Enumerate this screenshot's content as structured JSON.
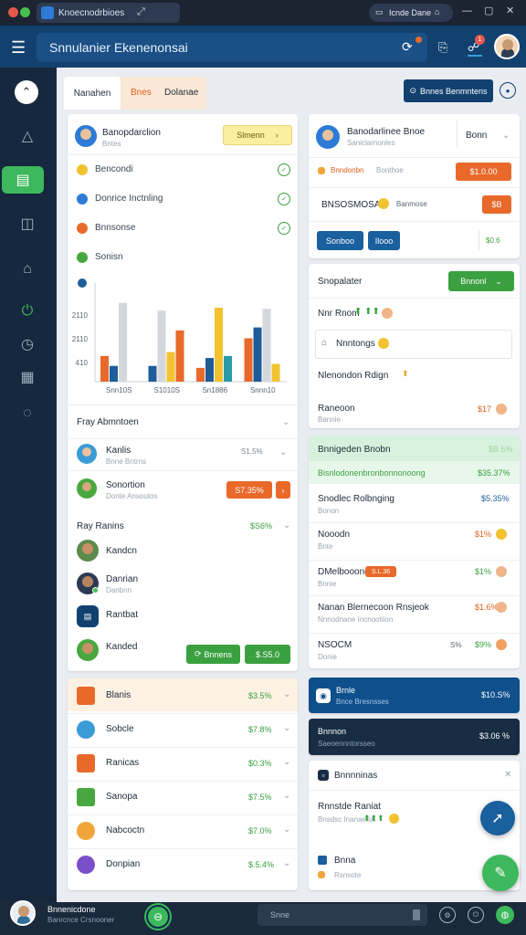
{
  "titlebar": {
    "tab_title": "Knoecnodrbioes",
    "url_text": "Icnde Dane"
  },
  "header": {
    "title": "Snnulanier Ekenenonsai",
    "badge": "1"
  },
  "top_tabs": {
    "tab1": "Nanahen",
    "tab2": "Bnes",
    "tab3": "Dolanae",
    "right_button": "Bnnes Benmntens"
  },
  "left_card": {
    "user_name": "Banopdarclion",
    "user_sub": "Bntes",
    "header_button": "Slmenn",
    "items": [
      {
        "label": "Bencondi",
        "color": "#f2c230"
      },
      {
        "label": "Donrice Inctnling",
        "color": "#2d7bd6"
      },
      {
        "label": "Bnnsonse",
        "color": "#e8692a"
      },
      {
        "label": "Sonisn",
        "color": "#48a83f"
      }
    ],
    "chart_ticks": [
      "2110",
      "2110",
      "410"
    ],
    "chart_categories": [
      "Snn10S",
      "S1010S",
      "Sn1886",
      "Snnn10"
    ]
  },
  "chart_data": {
    "type": "bar",
    "y_ticks": [
      "410",
      "2110",
      "2110"
    ],
    "categories": [
      "Snn10S",
      "S1010S",
      "Sn1886",
      "Snnn10"
    ],
    "series": [
      {
        "color": "#e8692a",
        "values": [
          26,
          0,
          14,
          44
        ]
      },
      {
        "color": "#1e5d9a",
        "values": [
          16,
          16,
          24,
          55
        ]
      },
      {
        "color": "#d4d7db",
        "values": [
          80,
          72,
          0,
          74
        ]
      },
      {
        "color": "#f2c230",
        "values": [
          0,
          30,
          75,
          18
        ]
      },
      {
        "color": "#e8692a",
        "values": [
          0,
          52,
          0,
          0
        ]
      },
      {
        "color": "#2a9aa8",
        "values": [
          0,
          0,
          26,
          0
        ]
      }
    ]
  },
  "fray_abms": {
    "title": "Fray Abmntoen"
  },
  "people": [
    {
      "name": "Kanlis",
      "sub": "Bnne Bntrns",
      "value": "S1.5%"
    },
    {
      "name": "Sonortion",
      "sub": "Donte Ansoutos",
      "button": "S7.35%"
    }
  ],
  "ray_ranins": {
    "title": "Ray Ranins",
    "value": "$S6%",
    "items": [
      "Kandcn",
      "Danrian",
      "Rantbat",
      "Kanded"
    ],
    "btn1": "Bnnens",
    "btn2": "$.S5.0"
  },
  "bottom_list": [
    {
      "name": "Blanis",
      "value": "$3.5%",
      "color": "#e8692a"
    },
    {
      "name": "Sobcle",
      "value": "$7.8%",
      "color": "#3b9bd6"
    },
    {
      "name": "Ranicas",
      "value": "$0.3%",
      "color": "#e8692a"
    },
    {
      "name": "Sanopa",
      "value": "$7.5%",
      "color": "#48a83f"
    },
    {
      "name": "Nabcoctn",
      "value": "$7.0%",
      "color": "#f0a53a"
    },
    {
      "name": "Donpian",
      "value": "$.5.4%",
      "color": "#7a4fc9"
    }
  ],
  "right_card1": {
    "name": "Banodarlinee Bnoe",
    "sub": "Saniclarnonles",
    "select": "Bonn",
    "line1_a": "Bnndonbn",
    "line1_b": "Bonthoe",
    "btn_orange1": "$1.0.00",
    "line2_a": "BNSOSMOSA",
    "line2_b": "Banmose",
    "btn_orange2": "$B",
    "btn_blue1": "Sonboo",
    "btn_blue2": "Ilooo",
    "value": "$0.6"
  },
  "snopalater": {
    "title": "Snopalater",
    "btn": "Bnnonl",
    "row1": "Nnr Rnom",
    "row2": "Nnntongs",
    "row3": "Nlenondon Rdign",
    "row4": "Raneoon",
    "row4_val": "$17"
  },
  "register": {
    "title": "Bnnigeden Bnobn",
    "title_val": "$B.5%",
    "sub": "Bisnlodonenbronbonnonoong",
    "sub_val": "$35.37%",
    "items": [
      {
        "name": "Snodlec Rolbnging",
        "sub": "Bonon",
        "val": "$5.35%"
      },
      {
        "name": "Nooodn",
        "sub": "Bnte",
        "val": "$1%"
      },
      {
        "name": "DMelbooond",
        "tag": "S.L.36",
        "sub": "Bnnie",
        "val": "$1%"
      },
      {
        "name": "Nanan Blernecoon Rnsjeok",
        "sub": "Nnnodnane Incnootiion",
        "val": "$1.6%"
      },
      {
        "name": "NSOCM",
        "sub": "Donie",
        "pct": "S%",
        "val": "$9%"
      }
    ]
  },
  "blue_card": {
    "title": "Brnle",
    "sub": "Bnce Bresnsses",
    "value": "$10.S%"
  },
  "dark_card": {
    "title": "Bnnnon",
    "sub": "Saeoennntorsseo",
    "value": "$3.06 %"
  },
  "bottom_right": {
    "title": "Bnnnninas",
    "item1": "Rnnstde Raniat",
    "item1_sub": "Bnsdsc Inanaeisn",
    "item2": "Bnna",
    "item2_sub": "Rsnsote"
  },
  "bottombar": {
    "user": "Bnnenicdone",
    "user_sub": "Banrcnce Crsnooner",
    "search": "Snne"
  }
}
